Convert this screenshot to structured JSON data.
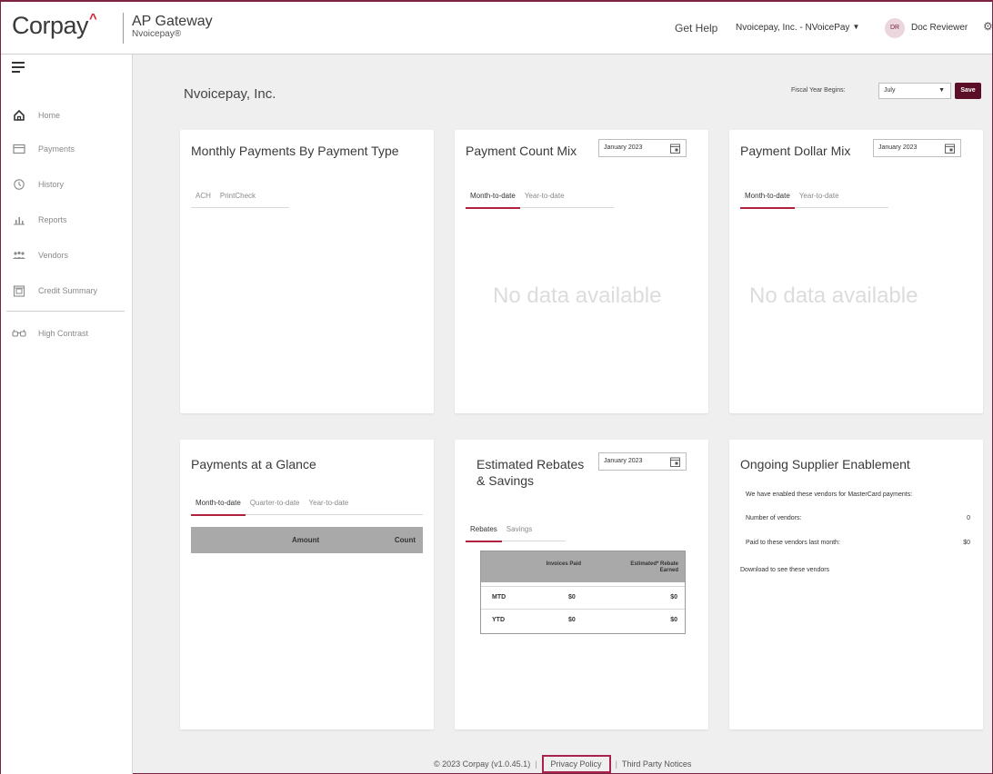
{
  "header": {
    "logo": "Corpay",
    "logo_caret": "^",
    "product_name": "AP Gateway",
    "product_sub": "Nvoicepay®",
    "get_help": "Get Help",
    "org": "Nvoicepay, Inc. - NVoicePay",
    "org_caret": "▼",
    "avatar": "DR",
    "user": "Doc Reviewer",
    "gear_icon": "⚙"
  },
  "sidebar": {
    "items": [
      {
        "label": "Home",
        "icon": "home-icon"
      },
      {
        "label": "Payments",
        "icon": "card-icon"
      },
      {
        "label": "History",
        "icon": "history-icon"
      },
      {
        "label": "Reports",
        "icon": "bar-chart-icon"
      },
      {
        "label": "Vendors",
        "icon": "people-icon"
      },
      {
        "label": "Credit Summary",
        "icon": "credit-summary-icon"
      }
    ],
    "high_contrast": "High Contrast"
  },
  "main": {
    "company": "Nvoicepay, Inc.",
    "fiscal_label": "Fiscal Year Begins:",
    "fiscal_value": "July",
    "fiscal_caret": "▼",
    "save": "Save"
  },
  "cards": {
    "monthly": {
      "title": "Monthly Payments By Payment Type",
      "tabs": [
        "ACH",
        "PrintCheck"
      ]
    },
    "count_mix": {
      "title": "Payment Count Mix",
      "date": "January 2023",
      "tabs": [
        "Month-to-date",
        "Year-to-date"
      ],
      "no_data": "No data available"
    },
    "dollar_mix": {
      "title": "Payment Dollar Mix",
      "date": "January 2023",
      "tabs": [
        "Month-to-date",
        "Year-to-date"
      ],
      "no_data": "No data available"
    },
    "glance": {
      "title": "Payments at a Glance",
      "tabs": [
        "Month-to-date",
        "Quarter-to-date",
        "Year-to-date"
      ],
      "col_amount": "Amount",
      "col_count": "Count"
    },
    "rebates": {
      "title": "Estimated Rebates & Savings",
      "date": "January 2023",
      "tabs": [
        "Rebates",
        "Savings"
      ],
      "col_invoices": "Invoices Paid",
      "col_estimated": "Estimated* Rebate Earned",
      "rows": [
        {
          "label": "MTD",
          "invoices": "$0",
          "estimated": "$0"
        },
        {
          "label": "YTD",
          "invoices": "$0",
          "estimated": "$0"
        }
      ]
    },
    "supplier": {
      "title": "Ongoing Supplier Enablement",
      "intro": "We have enabled these vendors for MasterCard payments:",
      "num_label": "Number of vendors:",
      "num_value": "0",
      "paid_label": "Paid to these vendors last month:",
      "paid_value": "$0",
      "download": "Download to see these vendors"
    }
  },
  "footer": {
    "copyright": "© 2023 Corpay (v1.0.45.1)",
    "sep": "|",
    "privacy": "Privacy Policy",
    "third_party": "Third Party Notices"
  }
}
